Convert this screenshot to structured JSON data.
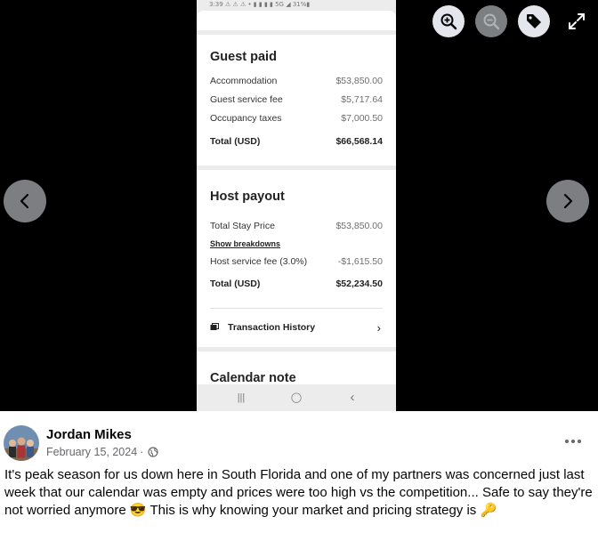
{
  "phone": {
    "status_bar": "3:39 ⚠ ⚠ ⚠ •   ▮ ▮ ▮ ▮ 5G ◢ 31%▮",
    "guest_paid": {
      "title": "Guest paid",
      "rows": [
        {
          "label": "Accommodation",
          "value": "$53,850.00"
        },
        {
          "label": "Guest service fee",
          "value": "$5,717.64"
        },
        {
          "label": "Occupancy taxes",
          "value": "$7,000.50"
        }
      ],
      "total": {
        "label": "Total (USD)",
        "value": "$66,568.14"
      }
    },
    "host_payout": {
      "title": "Host payout",
      "stay_price": {
        "label": "Total Stay Price",
        "value": "$53,850.00"
      },
      "breakdown_link": "Show breakdowns",
      "service_fee": {
        "label": "Host service fee (3.0%)",
        "value": "-$1,615.50"
      },
      "total": {
        "label": "Total (USD)",
        "value": "$52,234.50"
      }
    },
    "transaction_history": "Transaction History",
    "calendar_note": "Calendar note",
    "nav": {
      "recents": "|||",
      "home": "◯",
      "back": "‹"
    }
  },
  "viewer": {
    "tools": [
      "zoom-in",
      "zoom-out",
      "tag",
      "expand"
    ]
  },
  "post": {
    "author": "Jordan Mikes",
    "date": "February 15, 2024",
    "separator": "·",
    "text_part1": "It's peak season for us down here in South Florida and one of my partners was concerned just last week that our calendar was empty and prices were too high vs the competition... Safe to say they're not worried anymore",
    "emoji1": "😎",
    "text_part2": "This is why knowing your market and pricing strategy is",
    "emoji2": "🔑"
  }
}
